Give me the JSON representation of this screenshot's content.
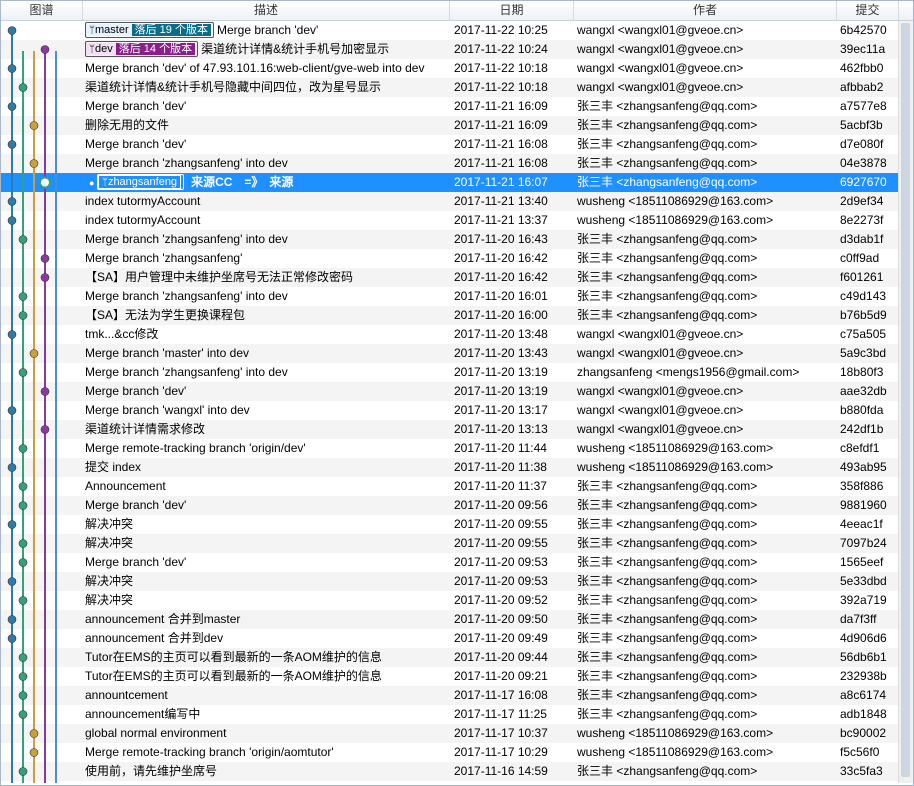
{
  "columns": {
    "graph": "图谱",
    "desc": "描述",
    "date": "日期",
    "author": "作者",
    "hash": "提交"
  },
  "colors": {
    "selected": "#1e90ff",
    "alt_row": "#f4f4f4",
    "lane1": "#2e7aa8",
    "lane2": "#c9a03b",
    "lane3": "#8a3a9a",
    "lane4": "#33a080",
    "lane5": "#4a8fd4"
  },
  "rows": [
    {
      "tags": [
        {
          "name": "master",
          "behind": "落后 19 个版本",
          "kind": "master"
        }
      ],
      "desc": "Merge branch 'dev'",
      "date": "2017-11-22 10:25",
      "author": "wangxl <wangxl01@gveoe.cn>",
      "hash": "6b42570"
    },
    {
      "tags": [
        {
          "name": "dev",
          "behind": "落后 14 个版本",
          "kind": "dev"
        }
      ],
      "desc": "渠道统计详情&统计手机号加密显示",
      "date": "2017-11-22 10:24",
      "author": "wangxl <wangxl01@gveoe.cn>",
      "hash": "39ec11a"
    },
    {
      "tags": [],
      "desc": "Merge branch 'dev' of 47.93.101.16:web-client/gve-web into dev",
      "date": "2017-11-22 10:18",
      "author": "wangxl <wangxl01@gveoe.cn>",
      "hash": "462fbb0"
    },
    {
      "tags": [],
      "desc": "渠道统计详情&统计手机号隐藏中间四位，改为星号显示",
      "date": "2017-11-22 10:18",
      "author": "wangxl <wangxl01@gveoe.cn>",
      "hash": "afbbab2"
    },
    {
      "tags": [],
      "desc": "Merge branch 'dev'",
      "date": "2017-11-21 16:09",
      "author": "张三丰 <zhangsanfeng@qq.com>",
      "hash": "a7577e8"
    },
    {
      "tags": [],
      "desc": "删除无用的文件",
      "date": "2017-11-21 16:09",
      "author": "张三丰 <zhangsanfeng@qq.com>",
      "hash": "5acbf3b"
    },
    {
      "tags": [],
      "desc": "Merge branch 'dev'",
      "date": "2017-11-21 16:08",
      "author": "张三丰 <zhangsanfeng@qq.com>",
      "hash": "d7e080f"
    },
    {
      "tags": [],
      "desc": "Merge branch 'zhangsanfeng' into dev",
      "date": "2017-11-21 16:08",
      "author": "张三丰 <zhangsanfeng@qq.com>",
      "hash": "04e3878"
    },
    {
      "tags": [
        {
          "name": "zhangsanfeng",
          "behind": "",
          "kind": "zs"
        }
      ],
      "desc": "来源CC　=》　来源",
      "date": "2017-11-21 16:07",
      "author": "张三丰 <zhangsanfeng@qq.com>",
      "hash": "6927670",
      "selected": true
    },
    {
      "tags": [],
      "desc": " index tutormyAccount",
      "date": "2017-11-21 13:40",
      "author": "wusheng <18511086929@163.com>",
      "hash": "2d9ef34"
    },
    {
      "tags": [],
      "desc": "index tutormyAccount",
      "date": "2017-11-21 13:37",
      "author": "wusheng <18511086929@163.com>",
      "hash": "8e2273f"
    },
    {
      "tags": [],
      "desc": "Merge branch 'zhangsanfeng' into dev",
      "date": "2017-11-20 16:43",
      "author": "张三丰 <zhangsanfeng@qq.com>",
      "hash": "d3dab1f"
    },
    {
      "tags": [],
      "desc": "Merge branch 'zhangsanfeng'",
      "date": "2017-11-20 16:42",
      "author": "张三丰 <zhangsanfeng@qq.com>",
      "hash": "c0ff9ad"
    },
    {
      "tags": [],
      "desc": "【SA】用户管理中未维护坐席号无法正常修改密码",
      "date": "2017-11-20 16:42",
      "author": "张三丰 <zhangsanfeng@qq.com>",
      "hash": "f601261"
    },
    {
      "tags": [],
      "desc": "Merge branch 'zhangsanfeng' into dev",
      "date": "2017-11-20 16:01",
      "author": "张三丰 <zhangsanfeng@qq.com>",
      "hash": "c49d143"
    },
    {
      "tags": [],
      "desc": "【SA】无法为学生更换课程包",
      "date": "2017-11-20 16:00",
      "author": "张三丰 <zhangsanfeng@qq.com>",
      "hash": "b76b5d9"
    },
    {
      "tags": [],
      "desc": "tmk...&cc修改",
      "date": "2017-11-20 13:48",
      "author": "wangxl <wangxl01@gveoe.cn>",
      "hash": "c75a505"
    },
    {
      "tags": [],
      "desc": "Merge branch 'master' into dev",
      "date": "2017-11-20 13:43",
      "author": "wangxl <wangxl01@gveoe.cn>",
      "hash": "5a9c3bd"
    },
    {
      "tags": [],
      "desc": "Merge branch 'zhangsanfeng' into dev",
      "date": "2017-11-20 13:19",
      "author": "zhangsanfeng <mengs1956@gmail.com>",
      "hash": "18b80f3"
    },
    {
      "tags": [],
      "desc": "Merge branch 'dev'",
      "date": "2017-11-20 13:19",
      "author": "wangxl <wangxl01@gveoe.cn>",
      "hash": "aae32db"
    },
    {
      "tags": [],
      "desc": "Merge branch 'wangxl' into dev",
      "date": "2017-11-20 13:17",
      "author": "wangxl <wangxl01@gveoe.cn>",
      "hash": "b880fda"
    },
    {
      "tags": [],
      "desc": "渠道统计详情需求修改",
      "date": "2017-11-20 13:13",
      "author": "wangxl <wangxl01@gveoe.cn>",
      "hash": "242df1b"
    },
    {
      "tags": [],
      "desc": "Merge remote-tracking branch 'origin/dev'",
      "date": "2017-11-20 11:44",
      "author": "wusheng <18511086929@163.com>",
      "hash": "c8efdf1"
    },
    {
      "tags": [],
      "desc": "提交 index",
      "date": "2017-11-20 11:38",
      "author": "wusheng <18511086929@163.com>",
      "hash": "493ab95"
    },
    {
      "tags": [],
      "desc": "Announcement",
      "date": "2017-11-20 11:37",
      "author": "张三丰 <zhangsanfeng@qq.com>",
      "hash": "358f886"
    },
    {
      "tags": [],
      "desc": "Merge branch 'dev'",
      "date": "2017-11-20 09:56",
      "author": "张三丰 <zhangsanfeng@qq.com>",
      "hash": "9881960"
    },
    {
      "tags": [],
      "desc": "解决冲突",
      "date": "2017-11-20 09:55",
      "author": "张三丰 <zhangsanfeng@qq.com>",
      "hash": "4eeac1f"
    },
    {
      "tags": [],
      "desc": "解决冲突",
      "date": "2017-11-20 09:55",
      "author": "张三丰 <zhangsanfeng@qq.com>",
      "hash": "7097b24"
    },
    {
      "tags": [],
      "desc": "Merge branch 'dev'",
      "date": "2017-11-20 09:53",
      "author": "张三丰 <zhangsanfeng@qq.com>",
      "hash": "1565eef"
    },
    {
      "tags": [],
      "desc": "解决冲突",
      "date": "2017-11-20 09:53",
      "author": "张三丰 <zhangsanfeng@qq.com>",
      "hash": "5e33dbd"
    },
    {
      "tags": [],
      "desc": "解决冲突",
      "date": "2017-11-20 09:52",
      "author": "张三丰 <zhangsanfeng@qq.com>",
      "hash": "392a719"
    },
    {
      "tags": [],
      "desc": "announcement 合并到master",
      "date": "2017-11-20 09:50",
      "author": "张三丰 <zhangsanfeng@qq.com>",
      "hash": "da7f3ff"
    },
    {
      "tags": [],
      "desc": "announcement 合并到dev",
      "date": "2017-11-20 09:49",
      "author": "张三丰 <zhangsanfeng@qq.com>",
      "hash": "4d906d6"
    },
    {
      "tags": [],
      "desc": "Tutor在EMS的主页可以看到最新的一条AOM维护的信息",
      "date": "2017-11-20 09:44",
      "author": "张三丰 <zhangsanfeng@qq.com>",
      "hash": "56db6b1"
    },
    {
      "tags": [],
      "desc": "Tutor在EMS的主页可以看到最新的一条AOM维护的信息",
      "date": "2017-11-20 09:21",
      "author": "张三丰 <zhangsanfeng@qq.com>",
      "hash": "232938b"
    },
    {
      "tags": [],
      "desc": "annountcement",
      "date": "2017-11-17 16:08",
      "author": "张三丰 <zhangsanfeng@qq.com>",
      "hash": "a8c6174"
    },
    {
      "tags": [],
      "desc": "announcement编写中",
      "date": "2017-11-17 11:25",
      "author": "张三丰 <zhangsanfeng@qq.com>",
      "hash": "adb1848"
    },
    {
      "tags": [],
      "desc": "global normal environment",
      "date": "2017-11-17 10:37",
      "author": "wusheng <18511086929@163.com>",
      "hash": "bc90002"
    },
    {
      "tags": [],
      "desc": "Merge remote-tracking branch 'origin/aomtutor'",
      "date": "2017-11-17 10:29",
      "author": "wusheng <18511086929@163.com>",
      "hash": "f5c56f0"
    },
    {
      "tags": [],
      "desc": "使用前，请先维护坐席号",
      "date": "2017-11-16 14:59",
      "author": "张三丰 <zhangsanfeng@qq.com>",
      "hash": "33c5fa3"
    }
  ]
}
